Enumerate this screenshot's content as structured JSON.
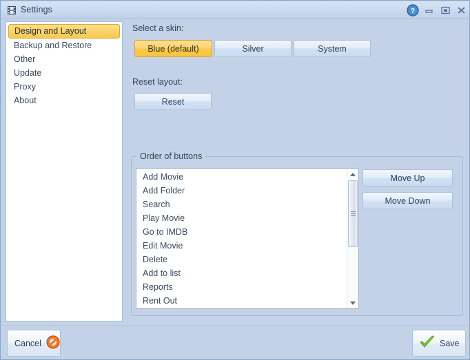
{
  "window": {
    "title": "Settings",
    "icon": "film-strip-icon",
    "controls": [
      {
        "name": "help-button",
        "glyph": "?"
      },
      {
        "name": "minimize-button",
        "glyph": "minimize"
      },
      {
        "name": "maximize-button",
        "glyph": "maximize"
      },
      {
        "name": "close-button",
        "glyph": "close"
      }
    ]
  },
  "sidebar": {
    "items": [
      {
        "label": "Design and Layout",
        "selected": true
      },
      {
        "label": "Backup and Restore",
        "selected": false
      },
      {
        "label": "Other",
        "selected": false
      },
      {
        "label": "Update",
        "selected": false
      },
      {
        "label": "Proxy",
        "selected": false
      },
      {
        "label": "About",
        "selected": false
      }
    ]
  },
  "main": {
    "skin": {
      "label": "Select a skin:",
      "options": [
        {
          "label": "Blue (default)",
          "selected": true
        },
        {
          "label": "Silver",
          "selected": false
        },
        {
          "label": "System",
          "selected": false
        }
      ]
    },
    "reset": {
      "label": "Reset layout:",
      "button_label": "Reset"
    },
    "order_of_buttons": {
      "legend": "Order of buttons",
      "items": [
        "Add Movie",
        "Add Folder",
        "Search",
        "Play Movie",
        "Go to IMDB",
        "Edit Movie",
        "Delete",
        "Add to list",
        "Reports",
        "Rent Out"
      ],
      "move_up_label": "Move Up",
      "move_down_label": "Move Down"
    }
  },
  "footer": {
    "cancel_label": "Cancel",
    "cancel_icon": "no-entry-icon",
    "save_label": "Save",
    "save_icon": "green-check-icon"
  },
  "colors": {
    "background": "#c3d2e6",
    "accent_selected": "#f9c948",
    "accent_border": "#d9a03a",
    "panel_white": "#ffffff",
    "text": "#3b4a5e",
    "cancel_icon": "#e2641f",
    "save_icon": "#6fb82c"
  }
}
